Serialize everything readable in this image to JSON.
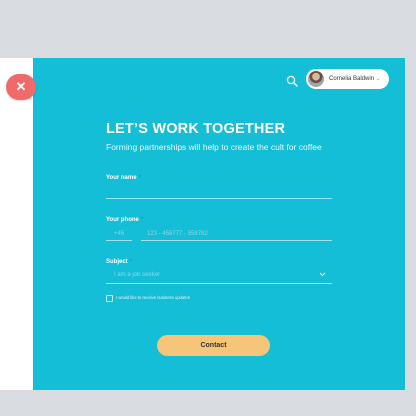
{
  "header": {
    "user_name": "Cornelia Baldwin",
    "user_chevron": "⌄"
  },
  "close_glyph": "✕",
  "form": {
    "title": "LET’S WORK TOGETHER",
    "subtitle": "Forming partnerships will help to create the cult for coffee",
    "name": {
      "label": "Your name",
      "required_mark": "*",
      "value": ""
    },
    "phone": {
      "label": "Your phone",
      "required_mark": "*",
      "country_code_placeholder": "+45",
      "number_placeholder": "123 - 458777 - 558782"
    },
    "subject": {
      "label": "Subject",
      "required_mark": "*",
      "selected": "I am a job seeker"
    },
    "checkbox": {
      "label": "I would like to receive business updates",
      "checked": false
    },
    "submit_label": "Contact"
  },
  "colors": {
    "accent": "#14bed6",
    "close": "#f06a6a",
    "button": "#f5c67a",
    "background": "#d9dce0"
  },
  "icons": [
    "close-icon",
    "search-icon",
    "avatar",
    "chevron-down-icon"
  ]
}
